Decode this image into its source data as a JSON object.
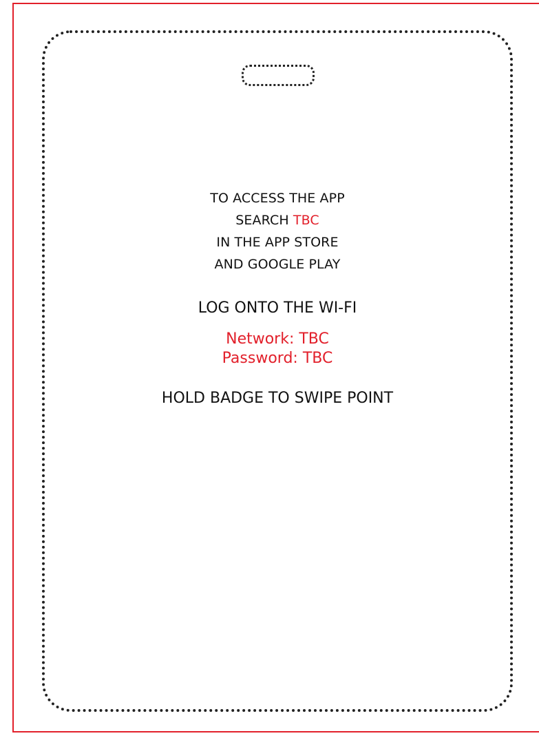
{
  "colors": {
    "accent": "#e21f2a",
    "text": "#111111",
    "outline": "#222222",
    "background": "#ffffff"
  },
  "app_access": {
    "line1": "TO ACCESS THE APP",
    "line2_prefix": "SEARCH ",
    "line2_highlight": "TBC",
    "line3": "IN THE APP STORE",
    "line4": "AND GOOGLE PLAY"
  },
  "wifi": {
    "heading": "LOG ONTO THE WI-FI",
    "network": "Network: TBC",
    "password": "Password: TBC"
  },
  "badge_instruction": "HOLD BADGE TO SWIPE POINT"
}
